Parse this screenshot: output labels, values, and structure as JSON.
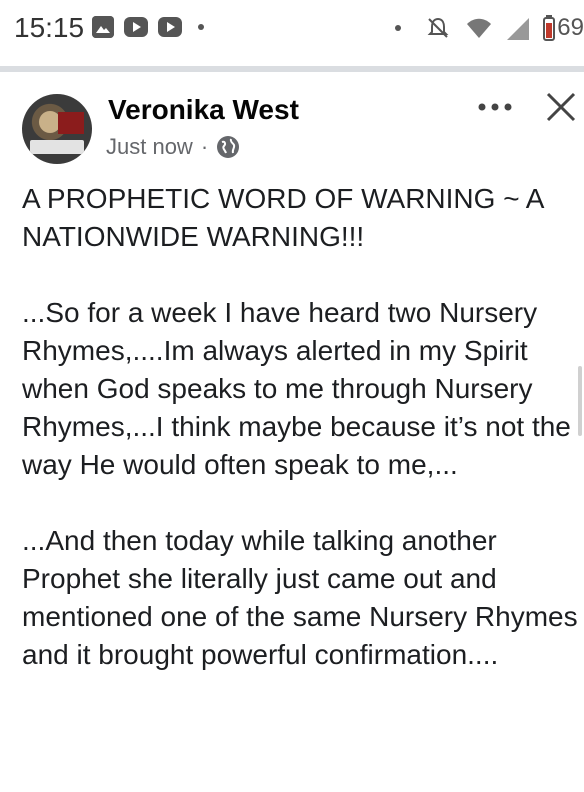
{
  "status_bar": {
    "time": "15:15",
    "battery": "69",
    "left_icons": [
      "gallery-icon",
      "youtube-icon",
      "youtube-icon"
    ],
    "right_icons": [
      "mute-icon",
      "wifi-icon",
      "signal-icon",
      "battery-icon"
    ]
  },
  "post": {
    "author": "Veronika West",
    "timestamp": "Just now",
    "separator": "·",
    "privacy_icon": "globe-icon",
    "more_icon": "more-icon",
    "close_icon": "close-icon",
    "paragraphs": [
      "A PROPHETIC WORD OF WARNING ~ A NATIONWIDE WARNING!!!",
      "...So for a week I have heard two Nursery Rhymes,....Im always alerted in my Spirit when God speaks to me through Nursery Rhymes,...I think maybe because it’s not the way He would often speak to me,...",
      "...And then today while talking another Prophet she literally just came out and mentioned one of the same Nursery Rhymes and it brought powerful confirmation...."
    ]
  }
}
